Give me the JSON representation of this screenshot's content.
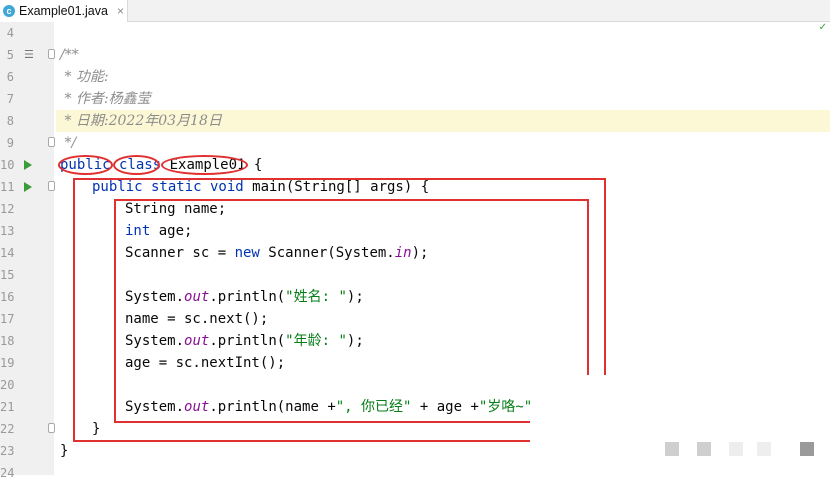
{
  "tab": {
    "file_name": "Example01.java",
    "icon_letter": "c",
    "close_glyph": "×"
  },
  "scroll_indicator": "✓",
  "lines": [
    {
      "num": "4"
    },
    {
      "num": "5",
      "text": "/**"
    },
    {
      "num": "6",
      "text": " * 功能:"
    },
    {
      "num": "7",
      "text": " * 作者:杨鑫莹"
    },
    {
      "num": "8",
      "text": " * 日期:2022年03月18日"
    },
    {
      "num": "9",
      "text": " */"
    },
    {
      "num": "10",
      "kw1": "public",
      "kw2": "class",
      "name": "Example01",
      "brace": " {"
    },
    {
      "num": "11",
      "kw": "public static void",
      "method": " main(String[] args) {"
    },
    {
      "num": "12",
      "text": "String name;"
    },
    {
      "num": "13",
      "kw": "int",
      "rest": " age;"
    },
    {
      "num": "14",
      "a": "Scanner sc = ",
      "kw": "new",
      "b": " Scanner(System.",
      "fld": "in",
      "c": ");"
    },
    {
      "num": "15"
    },
    {
      "num": "16",
      "a": "System.",
      "fld": "out",
      "b": ".println(",
      "str": "\"姓名: \"",
      "c": ");"
    },
    {
      "num": "17",
      "text": "name = sc.next();"
    },
    {
      "num": "18",
      "a": "System.",
      "fld": "out",
      "b": ".println(",
      "str": "\"年龄: \"",
      "c": ");"
    },
    {
      "num": "19",
      "text": "age = sc.nextInt();"
    },
    {
      "num": "20"
    },
    {
      "num": "21",
      "a": "System.",
      "fld": "out",
      "b": ".println(name +",
      "str1": "\", 你已经\"",
      "mid": " + age +",
      "str2": "\"岁咯~\""
    },
    {
      "num": "22",
      "text": "}"
    },
    {
      "num": "23",
      "text": "}"
    },
    {
      "num": "24"
    }
  ]
}
